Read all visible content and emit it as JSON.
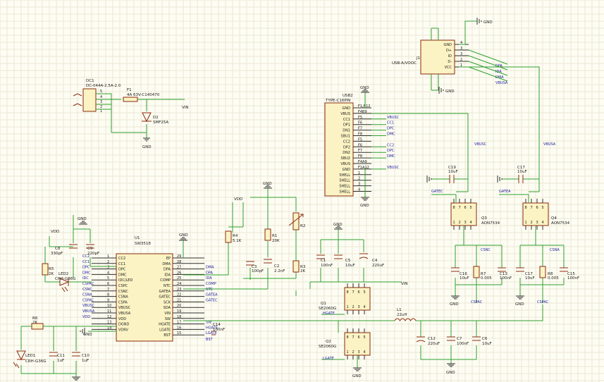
{
  "colors": {
    "wire": "#2ea02e",
    "body": "#8b2a0c",
    "fill": "#fbf3c4",
    "net": "#1c1c9c",
    "ink": "#1a1a1a"
  },
  "power": {
    "gnd": "GND",
    "vin": "VIN",
    "vdd": "VDD"
  },
  "dc1": {
    "ref": "DC1",
    "value": "DC-044A-2.5A-2.0",
    "pins": [
      "5",
      "4",
      "3",
      "2",
      "1"
    ]
  },
  "f1": {
    "ref": "F1",
    "value": "4A 63V-C140470"
  },
  "d2": {
    "ref": "D2",
    "value": "SMF25A"
  },
  "u1": {
    "ref": "U1",
    "value": "SW3518",
    "left_pins": [
      {
        "n": "1",
        "name": "CC2",
        "net": "CC2"
      },
      {
        "n": "2",
        "name": "CC1",
        "net": "CC1"
      },
      {
        "n": "3",
        "name": "DPC",
        "net": "DPC"
      },
      {
        "n": "4",
        "name": "DMC",
        "net": "DMC"
      },
      {
        "n": "5",
        "name": "IDC/LED",
        "net": "IDC"
      },
      {
        "n": "6",
        "name": "CSPC",
        "net": "CSPAC"
      },
      {
        "n": "7",
        "name": "CSNC",
        "net": "CSNC"
      },
      {
        "n": "8",
        "name": "CSNA",
        "net": "CSNA"
      },
      {
        "n": "9",
        "name": "CSPA",
        "net": "CSPAC"
      },
      {
        "n": "10",
        "name": "VBUSC",
        "net": "VBUSC"
      },
      {
        "n": "11",
        "name": "VBUSA",
        "net": "VBUSA"
      },
      {
        "n": "12",
        "name": "VDD",
        "net": "VDD"
      },
      {
        "n": "13",
        "name": "DGND",
        "net": ""
      },
      {
        "n": "14",
        "name": "VDRV",
        "net": ""
      }
    ],
    "right_pins": [
      {
        "n": "29",
        "name": "EP",
        "net": ""
      },
      {
        "n": "28",
        "name": "DMA",
        "net": ""
      },
      {
        "n": "27",
        "name": "DPA",
        "net": "DMA"
      },
      {
        "n": "26",
        "name": "IDA",
        "net": "DPA"
      },
      {
        "n": "25",
        "name": "COMP",
        "net": "IDA"
      },
      {
        "n": "24",
        "name": "NTC",
        "net": "COMP"
      },
      {
        "n": "23",
        "name": "GATEA",
        "net": "NTC"
      },
      {
        "n": "22",
        "name": "GATEC",
        "net": "GATEA"
      },
      {
        "n": "21",
        "name": "SCK",
        "net": "GATEC"
      },
      {
        "n": "20",
        "name": "SDA",
        "net": ""
      },
      {
        "n": "19",
        "name": "VIN",
        "net": ""
      },
      {
        "n": "18",
        "name": "SW",
        "net": ""
      },
      {
        "n": "17",
        "name": "HGATE",
        "net": "SW"
      },
      {
        "n": "16",
        "name": "LGATE",
        "net": "HGATE"
      },
      {
        "n": "15",
        "name": "BST",
        "net": "LGATE"
      }
    ],
    "bst_net": "BST"
  },
  "usb2": {
    "ref": "USB2",
    "value": "TYPE-C16PIN",
    "pins": [
      {
        "name": "GND",
        "num": "F1,B12",
        "net": ""
      },
      {
        "name": "VBUS",
        "num": "F4B9",
        "net": ""
      },
      {
        "name": "CC1",
        "num": "F5",
        "net": "VBUSC"
      },
      {
        "name": "DP1",
        "num": "F6",
        "net": "CC1"
      },
      {
        "name": "DN1",
        "num": "F7",
        "net": "DPC"
      },
      {
        "name": "SBU1",
        "num": "F8",
        "net": "DMC"
      },
      {
        "name": "CC2",
        "num": "F5",
        "net": ""
      },
      {
        "name": "DP2",
        "num": "F6",
        "net": "CC2"
      },
      {
        "name": "DN2",
        "num": "F7",
        "net": "DPC"
      },
      {
        "name": "SBU2",
        "num": "F8",
        "net": "DMC"
      },
      {
        "name": "VBUS",
        "num": "F4A9",
        "net": ""
      },
      {
        "name": "GND",
        "num": "F1A12",
        "net": "VBUSC"
      },
      {
        "name": "SHELL",
        "num": "1",
        "net": ""
      },
      {
        "name": "SHELL",
        "num": "2",
        "net": ""
      },
      {
        "name": "SHELL",
        "num": "3",
        "net": ""
      },
      {
        "name": "SHELL",
        "num": "4",
        "net": ""
      }
    ]
  },
  "j1": {
    "ref": "J1",
    "value": "USB-A/VOOC",
    "pins": [
      {
        "name": "GND",
        "num": "4",
        "net": ""
      },
      {
        "name": "D+",
        "num": "3",
        "net": "DPA"
      },
      {
        "name": "ID",
        "num": "3",
        "net": "IDA"
      },
      {
        "name": "D-",
        "num": "2",
        "net": "DMA"
      },
      {
        "name": "VCC",
        "num": "1",
        "net": "VBUSA"
      }
    ]
  },
  "resistors": [
    {
      "ref": "R4",
      "value": "5.1K"
    },
    {
      "ref": "R1",
      "value": "20K"
    },
    {
      "ref": "R2",
      "value": ""
    },
    {
      "ref": "R3",
      "value": "2K"
    },
    {
      "ref": "R5",
      "value": "2K"
    },
    {
      "ref": "R6",
      "value": "2K"
    },
    {
      "ref": "R7",
      "value": "0.005"
    },
    {
      "ref": "R8",
      "value": "0.005"
    }
  ],
  "caps": [
    {
      "ref": "C1",
      "value": "100nF"
    },
    {
      "ref": "C2",
      "value": "2.2nF"
    },
    {
      "ref": "C3",
      "value": "100pF"
    },
    {
      "ref": "C4",
      "value": "220uF"
    },
    {
      "ref": "C5",
      "value": "10uF"
    },
    {
      "ref": "C6",
      "value": "10uF"
    },
    {
      "ref": "C7",
      "value": "100nF"
    },
    {
      "ref": "C8",
      "value": "330pF"
    },
    {
      "ref": "C9",
      "value": "220pF"
    },
    {
      "ref": "C10",
      "value": "1uF"
    },
    {
      "ref": "C11",
      "value": "1uF"
    },
    {
      "ref": "C12",
      "value": "220uF"
    },
    {
      "ref": "C13",
      "value": "100nF"
    },
    {
      "ref": "C14",
      "value": "100nF"
    },
    {
      "ref": "C15",
      "value": "100nF"
    },
    {
      "ref": "C16",
      "value": "10uF"
    },
    {
      "ref": "C17",
      "value": "10uF"
    },
    {
      "ref": "C18",
      "value": "10uF"
    },
    {
      "ref": "C19",
      "value": "10uF"
    }
  ],
  "leds": [
    {
      "ref": "LED1",
      "value": "CRH-G36G"
    },
    {
      "ref": "LED2",
      "value": "CRH-G36G"
    }
  ],
  "mosfets": [
    {
      "ref": "Q1",
      "value": "SE2060G",
      "pins": [
        "1",
        "2",
        "3",
        "4",
        "5",
        "6",
        "7",
        "8"
      ]
    },
    {
      "ref": "Q2",
      "value": "SE2060G",
      "pins": [
        "1",
        "2",
        "3",
        "4",
        "5",
        "6",
        "7",
        "8"
      ]
    },
    {
      "ref": "Q3",
      "value": "AON7534",
      "pins": [
        "1",
        "2",
        "3",
        "4",
        "5",
        "6",
        "7",
        "8"
      ]
    },
    {
      "ref": "Q4",
      "value": "AON7534",
      "pins": [
        "1",
        "2",
        "3",
        "4",
        "5",
        "6",
        "7",
        "8"
      ]
    }
  ],
  "l1": {
    "ref": "L1",
    "value": "22uH"
  },
  "nets": {
    "vbusc": "VBUSC",
    "vbusa": "VBUSA",
    "gatec": "GATEC",
    "gatea": "GATEA",
    "csnc": "CSNC",
    "csna": "CSNA",
    "cspac": "CSPAC",
    "hgate": "HGATE",
    "lgate": "LGATE",
    "ntc": "NTC",
    "comp": "COMP",
    "vdd": "VDD"
  }
}
